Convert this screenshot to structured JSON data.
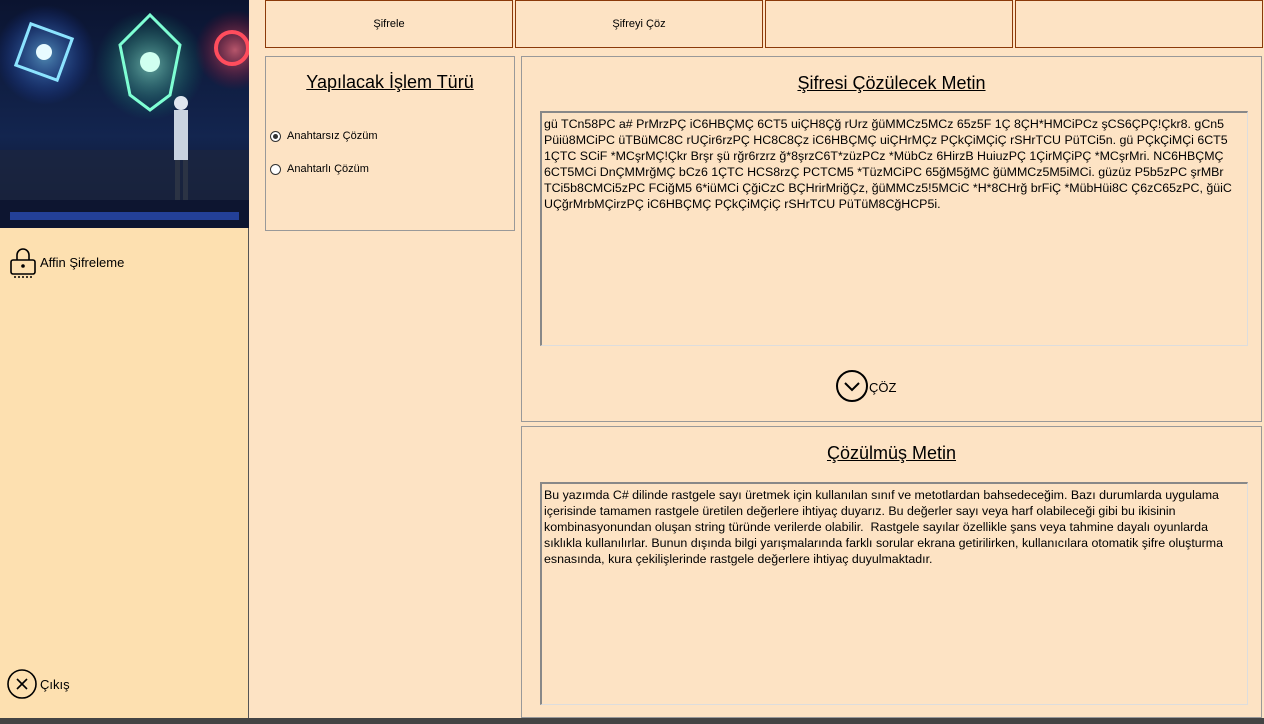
{
  "sidebar": {
    "menu_items": [
      {
        "label": "Affin Şifreleme",
        "icon": "lock-icon"
      },
      {
        "label": "Çıkış",
        "icon": "close-circle-icon"
      }
    ]
  },
  "tabs": [
    {
      "label": "Şifrele"
    },
    {
      "label": "Şifreyi Çöz"
    },
    {
      "label": ""
    },
    {
      "label": ""
    }
  ],
  "operation": {
    "title": "Yapılacak İşlem Türü",
    "options": [
      {
        "label": "Anahtarsız Çözüm",
        "selected": true
      },
      {
        "label": "Anahtarlı Çözüm",
        "selected": false
      }
    ]
  },
  "cipher": {
    "title": "Şifresi Çözülecek Metin",
    "text": "gü TCn58PC a# PrMrzPÇ iC6HBÇMÇ 6CT5 uiÇH8Çğ rUrz ğüMMCz5MCz 65z5F 1Ç 8ÇH*HMCiPCz şCS6ÇPÇ!Çkr8. gCn5 Püiü8MCiPC üTBüMC8C rUÇir6rzPÇ HC8C8Çz iC6HBÇMÇ uiÇHrMÇz PÇkÇiMÇiÇ rSHrTCU PüTCi5n. gü PÇkÇiMÇi 6CT5 1ÇTC SCiF *MCşrMÇ!Çkr Brşr şü rğr6rzrz ğ*8şrzC6T*züzPCz *MübCz 6HirzB HuiuzPÇ 1ÇirMÇiPÇ *MCşrMri. NC6HBÇMÇ 6CT5MCi DnÇMMrğMÇ bCz6 1ÇTC HCS8rzÇ PCTCM5 *TüzMCiPC 65ğM5ğMC ğüMMCz5M5iMCi. güzüz P5b5zPC şrMBr TCi5b8CMCi5zPC FCiğM5 6*iüMCi ÇğiCzC BÇHrirMriğÇz, ğüMMCz5!5MCiC *H*8CHrğ brFiÇ *MübHüi8C Ç6zC65zPC, ğüiC UÇğrMrbMÇirzPÇ iC6HBÇMÇ PÇkÇiMÇiÇ rSHrTCU PüTüM8CğHCP5i.",
    "solve_label": "ÇÖZ"
  },
  "plain": {
    "title": "Çözülmüş Metin",
    "text": "Bu yazımda C# dilinde rastgele sayı üretmek için kullanılan sınıf ve metotlardan bahsedeceğim. Bazı durumlarda uygulama içerisinde tamamen rastgele üretilen değerlere ihtiyaç duyarız. Bu değerler sayı veya harf olabileceği gibi bu ikisinin kombinasyonundan oluşan string türünde verilerde olabilir.  Rastgele sayılar özellikle şans veya tahmine dayalı oyunlarda sıklıkla kullanılırlar. Bunun dışında bilgi yarışmalarında farklı sorular ekrana getirilirken, kullanıcılara otomatik şifre oluşturma esnasında, kura çekilişlerinde rastgele değerlere ihtiyaç duyulmaktadır."
  }
}
